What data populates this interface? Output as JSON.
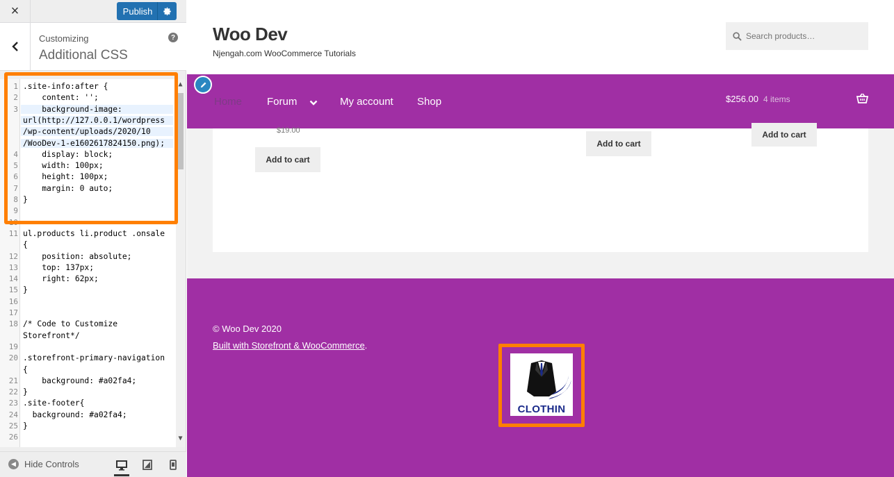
{
  "customizer": {
    "close_label": "×",
    "publish_label": "Publish",
    "customizing_label": "Customizing",
    "section_title": "Additional CSS",
    "help_label": "?",
    "hide_controls_label": "Hide Controls"
  },
  "code_lines": [
    {
      "n": "1",
      "t": ".site-info:after {"
    },
    {
      "n": "2",
      "t": "    content: '';"
    },
    {
      "n": "3",
      "t": "    background-image:"
    },
    {
      "n": "",
      "t": "url(http://127.0.0.1/wordpress"
    },
    {
      "n": "",
      "t": "/wp-content/uploads/2020/10"
    },
    {
      "n": "",
      "t": "/WooDev-1-e1602617824150.png);"
    },
    {
      "n": "4",
      "t": "    display: block;"
    },
    {
      "n": "5",
      "t": "    width: 100px;"
    },
    {
      "n": "6",
      "t": "    height: 100px;"
    },
    {
      "n": "7",
      "t": "    margin: 0 auto;"
    },
    {
      "n": "8",
      "t": "}"
    },
    {
      "n": "9",
      "t": ""
    },
    {
      "n": "10",
      "t": ""
    },
    {
      "n": "11",
      "t": "ul.products li.product .onsale"
    },
    {
      "n": "",
      "t": "{"
    },
    {
      "n": "12",
      "t": "    position: absolute;"
    },
    {
      "n": "13",
      "t": "    top: 137px;"
    },
    {
      "n": "14",
      "t": "    right: 62px;"
    },
    {
      "n": "15",
      "t": "}"
    },
    {
      "n": "16",
      "t": ""
    },
    {
      "n": "17",
      "t": ""
    },
    {
      "n": "18",
      "t": "/* Code to Customize"
    },
    {
      "n": "",
      "t": "Storefront*/"
    },
    {
      "n": "19",
      "t": ""
    },
    {
      "n": "20",
      "t": ".storefront-primary-navigation"
    },
    {
      "n": "",
      "t": "{"
    },
    {
      "n": "21",
      "t": "    background: #a02fa4;"
    },
    {
      "n": "22",
      "t": "}"
    },
    {
      "n": "23",
      "t": ".site-footer{"
    },
    {
      "n": "24",
      "t": "  background: #a02fa4;"
    },
    {
      "n": "25",
      "t": "}"
    },
    {
      "n": "26",
      "t": ""
    }
  ],
  "site": {
    "title": "Woo Dev",
    "description": "Njengah.com WooCommerce Tutorials",
    "search_placeholder": "Search products…"
  },
  "nav": {
    "home": "Home",
    "forum": "Forum",
    "account": "My account",
    "shop": "Shop",
    "cart_total": "$256.00",
    "cart_count": "4 items"
  },
  "products": {
    "price": "$19.00",
    "add_to_cart": "Add to cart"
  },
  "footer": {
    "copyright": "© Woo Dev 2020",
    "built_with": "Built with Storefront & WooCommerce",
    "built_with_suffix": ".",
    "logo_text": "CLOTHIN"
  },
  "colors": {
    "accent": "#a02fa4",
    "publish": "#2271b1",
    "highlight": "#ff7f00"
  }
}
